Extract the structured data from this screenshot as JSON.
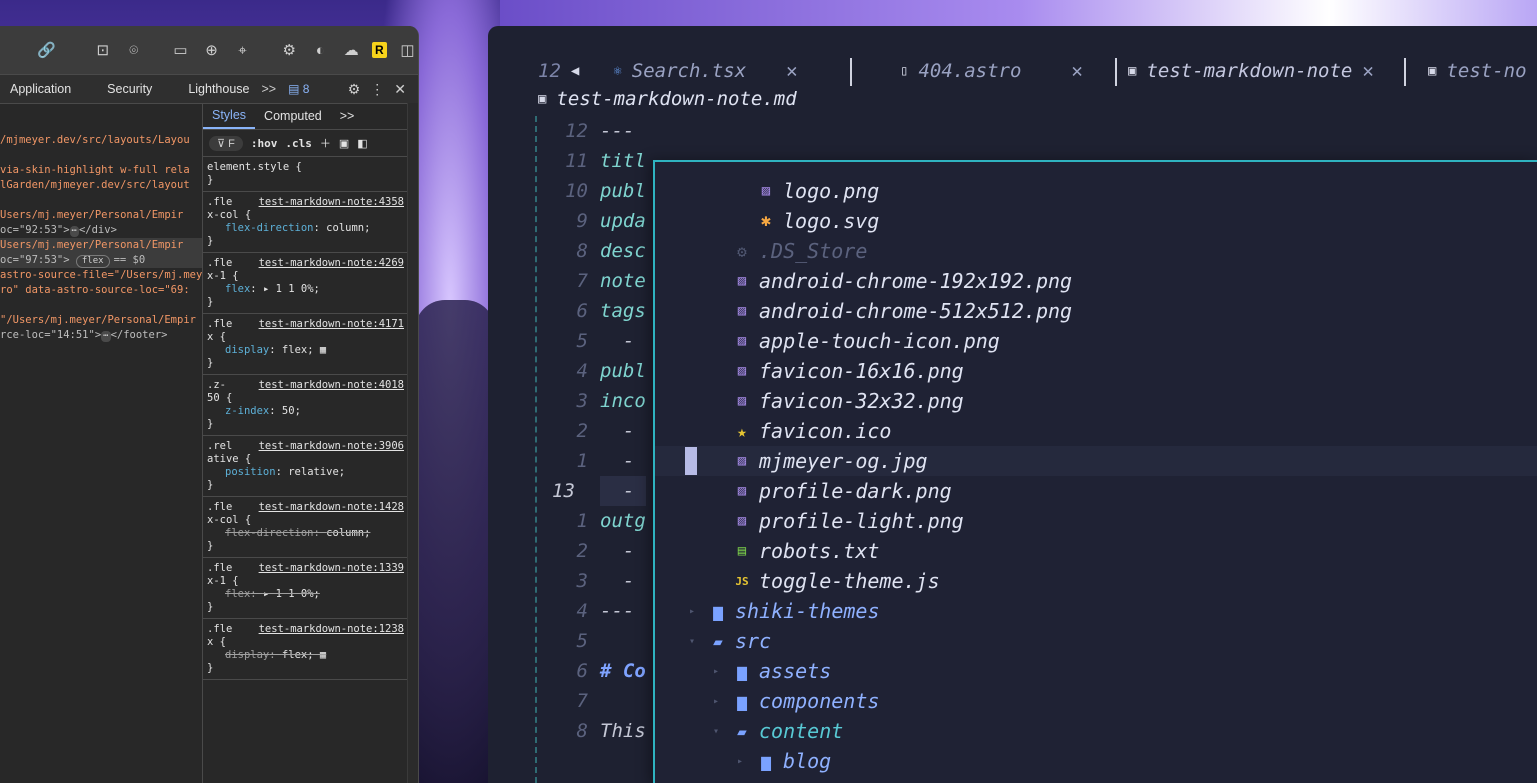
{
  "devtools": {
    "toolbar_icons": [
      "link-icon",
      "screenshot-icon",
      "camera-icon",
      "console-icon",
      "globe-icon",
      "target-icon",
      "extension-icon",
      "vue-icon",
      "cloud-icon",
      "r-icon",
      "split-icon"
    ],
    "r_badge": "R",
    "tabs": [
      "Application",
      "Security",
      "Lighthouse"
    ],
    "more": ">>",
    "message_count": "8",
    "elements_lines": [
      {
        "text": "",
        "cls": "gray"
      },
      {
        "text": "",
        "cls": "gray"
      },
      {
        "text": "/mjmeyer.dev/src/layouts/Layou",
        "cls": "orange"
      },
      {
        "text": "",
        "cls": "gray"
      },
      {
        "text": "via-skin-highlight w-full rela",
        "cls": "orange"
      },
      {
        "text": "lGarden/mjmeyer.dev/src/layout",
        "cls": "orange"
      },
      {
        "text": "",
        "cls": "gray"
      },
      {
        "text": "Users/mj.meyer/Personal/Empir",
        "cls": "orange"
      },
      {
        "text": "oc=\"92:53\">",
        "cls": "gray",
        "tail": "</div>"
      },
      {
        "text": "Users/mj.meyer/Personal/Empir",
        "cls": "orange",
        "sel": true
      },
      {
        "text": "oc=\"97:53\">",
        "cls": "gray",
        "pill": "flex",
        "eq": "== $0",
        "sel": true
      },
      {
        "text": "astro-source-file=\"/Users/mj.mey",
        "cls": "orange"
      },
      {
        "text": "ro\" data-astro-source-loc=\"69:",
        "cls": "orange"
      },
      {
        "text": "",
        "cls": "gray"
      },
      {
        "text": "\"/Users/mj.meyer/Personal/Empir",
        "cls": "orange"
      },
      {
        "text": "rce-loc=\"14:51\">",
        "cls": "gray",
        "tail": "</footer>"
      }
    ],
    "styles_tabs": [
      "Styles",
      "Computed"
    ],
    "filter": "F",
    "hov": ":hov",
    "cls": ".cls",
    "element_style": "element.style {",
    "rules": [
      {
        "src": "test-markdown-note:4358",
        "sel": ".fle\nx-col {",
        "props": [
          {
            "n": "flex-direction",
            "v": "column;"
          }
        ],
        "strike": false
      },
      {
        "src": "test-markdown-note:4269",
        "sel": ".fle\nx-1 {",
        "props": [
          {
            "n": "flex",
            "v": "▸ 1 1 0%;"
          }
        ],
        "strike": false
      },
      {
        "src": "test-markdown-note:4171",
        "sel": ".fle\nx {",
        "props": [
          {
            "n": "display",
            "v": "flex; ▦"
          }
        ],
        "strike": false
      },
      {
        "src": "test-markdown-note:4018",
        "sel": ".z-\n50 {",
        "props": [
          {
            "n": "z-index",
            "v": "50;"
          }
        ],
        "strike": false
      },
      {
        "src": "test-markdown-note:3906",
        "sel": ".rel\native {",
        "props": [
          {
            "n": "position",
            "v": "relative;"
          }
        ],
        "strike": false
      },
      {
        "src": "test-markdown-note:1428",
        "sel": ".fle\nx-col {",
        "props": [
          {
            "n": "flex-direction",
            "v": "column;"
          }
        ],
        "strike": true
      },
      {
        "src": "test-markdown-note:1339",
        "sel": ".fle\nx-1 {",
        "props": [
          {
            "n": "flex",
            "v": "▸ 1 1 0%;"
          }
        ],
        "strike": true
      },
      {
        "src": "test-markdown-note:1238",
        "sel": ".fle\nx {",
        "props": [
          {
            "n": "display",
            "v": "flex; ▦"
          }
        ],
        "strike": true
      }
    ]
  },
  "editor": {
    "tabs": [
      {
        "num": "12",
        "icon": "react-icon",
        "label": "Search.tsx"
      },
      {
        "icon": "file-icon",
        "label": "404.astro"
      },
      {
        "icon": "markdown-icon",
        "label": "test-markdown-note"
      },
      {
        "icon": "markdown-icon",
        "label": "test-no"
      }
    ],
    "breadcrumb": "test-markdown-note.md",
    "line_numbers": [
      "12",
      "11",
      "10",
      "9",
      "8",
      "7",
      "6",
      "5",
      "4",
      "3",
      "2",
      "1",
      "13",
      "1",
      "2",
      "3",
      "4",
      "5",
      "6",
      "7",
      "8"
    ],
    "code_lines": [
      "---",
      "titl",
      "publ",
      "upda",
      "desc",
      "note",
      "tags",
      "  -",
      "publ",
      "inco",
      "  -",
      "  -",
      "  -",
      "outg",
      "  -",
      "  -",
      "---",
      "",
      "# Co",
      "",
      "This"
    ],
    "tree": [
      {
        "indent": 3,
        "icon": "image-icon",
        "name": "logo.png"
      },
      {
        "indent": 3,
        "icon": "svg-icon",
        "name": "logo.svg"
      },
      {
        "indent": 2,
        "icon": "gear-icon",
        "name": ".DS_Store",
        "dim": true
      },
      {
        "indent": 2,
        "icon": "image-icon",
        "name": "android-chrome-192x192.png"
      },
      {
        "indent": 2,
        "icon": "image-icon",
        "name": "android-chrome-512x512.png"
      },
      {
        "indent": 2,
        "icon": "image-icon",
        "name": "apple-touch-icon.png"
      },
      {
        "indent": 2,
        "icon": "image-icon",
        "name": "favicon-16x16.png"
      },
      {
        "indent": 2,
        "icon": "image-icon",
        "name": "favicon-32x32.png"
      },
      {
        "indent": 2,
        "icon": "star-icon",
        "name": "favicon.ico"
      },
      {
        "indent": 2,
        "icon": "image-icon",
        "name": "mjmeyer-og.jpg",
        "selected": true
      },
      {
        "indent": 2,
        "icon": "image-icon",
        "name": "profile-dark.png"
      },
      {
        "indent": 2,
        "icon": "image-icon",
        "name": "profile-light.png"
      },
      {
        "indent": 2,
        "icon": "text-file-icon",
        "name": "robots.txt"
      },
      {
        "indent": 2,
        "icon": "js-icon",
        "name": "toggle-theme.js"
      },
      {
        "indent": 1,
        "icon": "folder-icon",
        "name": "shiki-themes",
        "arrow": "▸",
        "folder": true
      },
      {
        "indent": 1,
        "icon": "folder-open-icon",
        "name": "src",
        "arrow": "▾",
        "folder": true
      },
      {
        "indent": 2,
        "icon": "folder-icon",
        "name": "assets",
        "arrow": "▸",
        "folder": true
      },
      {
        "indent": 2,
        "icon": "folder-icon",
        "name": "components",
        "arrow": "▸",
        "folder": true
      },
      {
        "indent": 2,
        "icon": "folder-open-icon",
        "name": "content",
        "arrow": "▾",
        "folder": true,
        "open": true
      },
      {
        "indent": 3,
        "icon": "folder-icon",
        "name": "blog",
        "arrow": "▸",
        "folder": true
      }
    ]
  }
}
